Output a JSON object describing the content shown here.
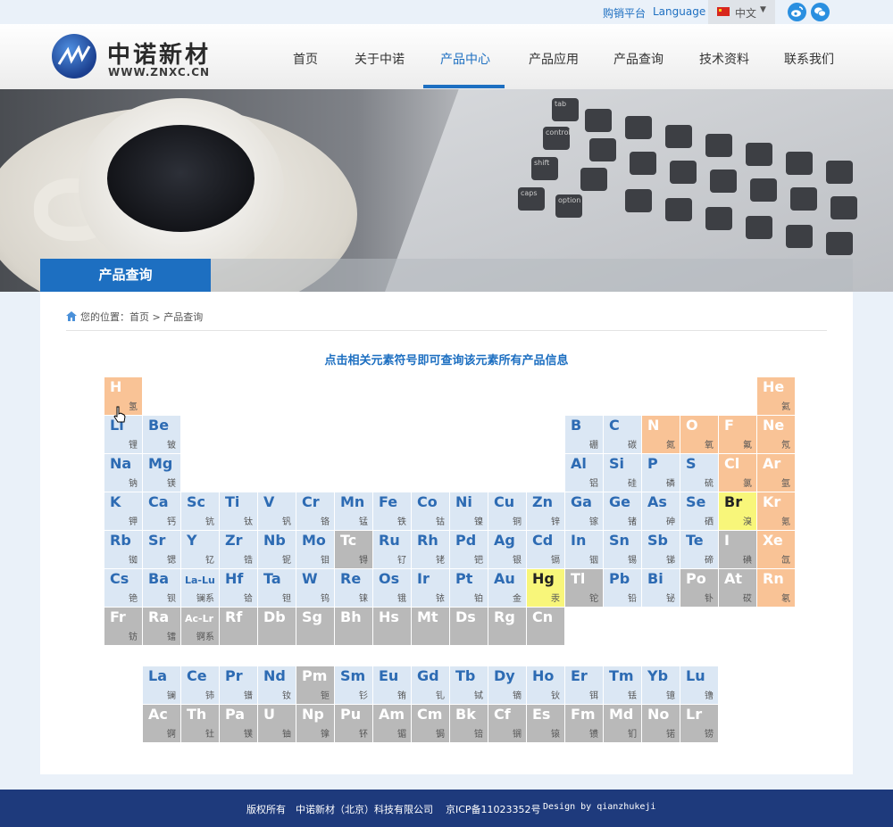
{
  "topbar": {
    "dealer_platform": "购销平台",
    "language": "Language",
    "lang_current": "中文",
    "social": [
      {
        "icon": "weibo-icon"
      },
      {
        "icon": "wechat-icon"
      }
    ]
  },
  "header": {
    "logo_cn": "中诺新材",
    "logo_en": "WWW.ZNXC.CN",
    "nav": [
      "首页",
      "关于中诺",
      "产品中心",
      "产品应用",
      "产品查询",
      "技术资料",
      "联系我们"
    ],
    "active_nav": "产品中心"
  },
  "banner": {
    "tab_title": "产品查询"
  },
  "breadcrumb": {
    "prefix": "您的位置：",
    "home": "首页",
    "separator": ">",
    "current": "产品查询"
  },
  "headline": "点击相关元素符号即可查询该元素所有产品信息",
  "elements": [
    {
      "s": "H",
      "c": "氢",
      "t": "orange"
    },
    {
      "s": "He",
      "c": "氦",
      "t": "orange"
    },
    {
      "s": "Li",
      "c": "锂",
      "t": "blue"
    },
    {
      "s": "Be",
      "c": "铍",
      "t": "blue"
    },
    {
      "s": "B",
      "c": "硼",
      "t": "blue"
    },
    {
      "s": "C",
      "c": "碳",
      "t": "blue"
    },
    {
      "s": "N",
      "c": "氮",
      "t": "orange"
    },
    {
      "s": "O",
      "c": "氧",
      "t": "orange"
    },
    {
      "s": "F",
      "c": "氟",
      "t": "orange"
    },
    {
      "s": "Ne",
      "c": "氖",
      "t": "orange"
    },
    {
      "s": "Na",
      "c": "钠",
      "t": "blue"
    },
    {
      "s": "Mg",
      "c": "镁",
      "t": "blue"
    },
    {
      "s": "Al",
      "c": "铝",
      "t": "blue"
    },
    {
      "s": "Si",
      "c": "硅",
      "t": "blue"
    },
    {
      "s": "P",
      "c": "磷",
      "t": "blue"
    },
    {
      "s": "S",
      "c": "硫",
      "t": "blue"
    },
    {
      "s": "Cl",
      "c": "氯",
      "t": "orange"
    },
    {
      "s": "Ar",
      "c": "氩",
      "t": "orange"
    },
    {
      "s": "K",
      "c": "钾",
      "t": "blue"
    },
    {
      "s": "Ca",
      "c": "钙",
      "t": "blue"
    },
    {
      "s": "Sc",
      "c": "钪",
      "t": "blue"
    },
    {
      "s": "Ti",
      "c": "钛",
      "t": "blue"
    },
    {
      "s": "V",
      "c": "钒",
      "t": "blue"
    },
    {
      "s": "Cr",
      "c": "铬",
      "t": "blue"
    },
    {
      "s": "Mn",
      "c": "锰",
      "t": "blue"
    },
    {
      "s": "Fe",
      "c": "铁",
      "t": "blue"
    },
    {
      "s": "Co",
      "c": "钴",
      "t": "blue"
    },
    {
      "s": "Ni",
      "c": "镍",
      "t": "blue"
    },
    {
      "s": "Cu",
      "c": "铜",
      "t": "blue"
    },
    {
      "s": "Zn",
      "c": "锌",
      "t": "blue"
    },
    {
      "s": "Ga",
      "c": "镓",
      "t": "blue"
    },
    {
      "s": "Ge",
      "c": "锗",
      "t": "blue"
    },
    {
      "s": "As",
      "c": "砷",
      "t": "blue"
    },
    {
      "s": "Se",
      "c": "硒",
      "t": "blue"
    },
    {
      "s": "Br",
      "c": "溴",
      "t": "yellow"
    },
    {
      "s": "Kr",
      "c": "氪",
      "t": "orange"
    },
    {
      "s": "Rb",
      "c": "铷",
      "t": "blue"
    },
    {
      "s": "Sr",
      "c": "锶",
      "t": "blue"
    },
    {
      "s": "Y",
      "c": "钇",
      "t": "blue"
    },
    {
      "s": "Zr",
      "c": "锆",
      "t": "blue"
    },
    {
      "s": "Nb",
      "c": "铌",
      "t": "blue"
    },
    {
      "s": "Mo",
      "c": "钼",
      "t": "blue"
    },
    {
      "s": "Tc",
      "c": "锝",
      "t": "gray"
    },
    {
      "s": "Ru",
      "c": "钌",
      "t": "blue"
    },
    {
      "s": "Rh",
      "c": "铑",
      "t": "blue"
    },
    {
      "s": "Pd",
      "c": "钯",
      "t": "blue"
    },
    {
      "s": "Ag",
      "c": "银",
      "t": "blue"
    },
    {
      "s": "Cd",
      "c": "镉",
      "t": "blue"
    },
    {
      "s": "In",
      "c": "铟",
      "t": "blue"
    },
    {
      "s": "Sn",
      "c": "锡",
      "t": "blue"
    },
    {
      "s": "Sb",
      "c": "锑",
      "t": "blue"
    },
    {
      "s": "Te",
      "c": "碲",
      "t": "blue"
    },
    {
      "s": "I",
      "c": "碘",
      "t": "gray"
    },
    {
      "s": "Xe",
      "c": "氙",
      "t": "orange"
    },
    {
      "s": "Cs",
      "c": "铯",
      "t": "blue"
    },
    {
      "s": "Ba",
      "c": "钡",
      "t": "blue"
    },
    {
      "s": "La-Lu",
      "c": "镧系",
      "t": "blue",
      "small": true
    },
    {
      "s": "Hf",
      "c": "铪",
      "t": "blue"
    },
    {
      "s": "Ta",
      "c": "钽",
      "t": "blue"
    },
    {
      "s": "W",
      "c": "钨",
      "t": "blue"
    },
    {
      "s": "Re",
      "c": "铼",
      "t": "blue"
    },
    {
      "s": "Os",
      "c": "锇",
      "t": "blue"
    },
    {
      "s": "Ir",
      "c": "铱",
      "t": "blue"
    },
    {
      "s": "Pt",
      "c": "铂",
      "t": "blue"
    },
    {
      "s": "Au",
      "c": "金",
      "t": "blue"
    },
    {
      "s": "Hg",
      "c": "汞",
      "t": "yellow"
    },
    {
      "s": "Tl",
      "c": "铊",
      "t": "gray"
    },
    {
      "s": "Pb",
      "c": "铅",
      "t": "blue"
    },
    {
      "s": "Bi",
      "c": "铋",
      "t": "blue"
    },
    {
      "s": "Po",
      "c": "钋",
      "t": "gray"
    },
    {
      "s": "At",
      "c": "砹",
      "t": "gray"
    },
    {
      "s": "Rn",
      "c": "氡",
      "t": "orange"
    },
    {
      "s": "Fr",
      "c": "钫",
      "t": "gray"
    },
    {
      "s": "Ra",
      "c": "镭",
      "t": "gray"
    },
    {
      "s": "Ac-Lr",
      "c": "锕系",
      "t": "gray",
      "small": true
    },
    {
      "s": "Rf",
      "c": "",
      "t": "gray"
    },
    {
      "s": "Db",
      "c": "",
      "t": "gray"
    },
    {
      "s": "Sg",
      "c": "",
      "t": "gray"
    },
    {
      "s": "Bh",
      "c": "",
      "t": "gray"
    },
    {
      "s": "Hs",
      "c": "",
      "t": "gray"
    },
    {
      "s": "Mt",
      "c": "",
      "t": "gray"
    },
    {
      "s": "Ds",
      "c": "",
      "t": "gray"
    },
    {
      "s": "Rg",
      "c": "",
      "t": "gray"
    },
    {
      "s": "Cn",
      "c": "",
      "t": "gray"
    },
    {
      "s": "La",
      "c": "镧",
      "t": "blue"
    },
    {
      "s": "Ce",
      "c": "铈",
      "t": "blue"
    },
    {
      "s": "Pr",
      "c": "镨",
      "t": "blue"
    },
    {
      "s": "Nd",
      "c": "钕",
      "t": "blue"
    },
    {
      "s": "Pm",
      "c": "钷",
      "t": "gray"
    },
    {
      "s": "Sm",
      "c": "钐",
      "t": "blue"
    },
    {
      "s": "Eu",
      "c": "铕",
      "t": "blue"
    },
    {
      "s": "Gd",
      "c": "钆",
      "t": "blue"
    },
    {
      "s": "Tb",
      "c": "铽",
      "t": "blue"
    },
    {
      "s": "Dy",
      "c": "镝",
      "t": "blue"
    },
    {
      "s": "Ho",
      "c": "钬",
      "t": "blue"
    },
    {
      "s": "Er",
      "c": "铒",
      "t": "blue"
    },
    {
      "s": "Tm",
      "c": "铥",
      "t": "blue"
    },
    {
      "s": "Yb",
      "c": "镱",
      "t": "blue"
    },
    {
      "s": "Lu",
      "c": "镥",
      "t": "blue"
    },
    {
      "s": "Ac",
      "c": "锕",
      "t": "gray"
    },
    {
      "s": "Th",
      "c": "钍",
      "t": "gray"
    },
    {
      "s": "Pa",
      "c": "镤",
      "t": "gray"
    },
    {
      "s": "U",
      "c": "铀",
      "t": "gray"
    },
    {
      "s": "Np",
      "c": "镎",
      "t": "gray"
    },
    {
      "s": "Pu",
      "c": "钚",
      "t": "gray"
    },
    {
      "s": "Am",
      "c": "镅",
      "t": "gray"
    },
    {
      "s": "Cm",
      "c": "锔",
      "t": "gray"
    },
    {
      "s": "Bk",
      "c": "锫",
      "t": "gray"
    },
    {
      "s": "Cf",
      "c": "锎",
      "t": "gray"
    },
    {
      "s": "Es",
      "c": "锿",
      "t": "gray"
    },
    {
      "s": "Fm",
      "c": "镄",
      "t": "gray"
    },
    {
      "s": "Md",
      "c": "钔",
      "t": "gray"
    },
    {
      "s": "No",
      "c": "锘",
      "t": "gray"
    },
    {
      "s": "Lr",
      "c": "铹",
      "t": "gray"
    }
  ],
  "footer": {
    "copyright": "版权所有",
    "company": "中诺新材（北京）科技有限公司",
    "icp": "京ICP备11023352号",
    "design": "Design by qianzhukeji"
  },
  "colors": {
    "accent": "#1d6fc1",
    "footer_bg": "#1e3a7c",
    "cell_blue": "#dbe7f4",
    "cell_orange": "#f9c396",
    "cell_gray": "#b9b9b9",
    "cell_yellow": "#f8f67a"
  }
}
